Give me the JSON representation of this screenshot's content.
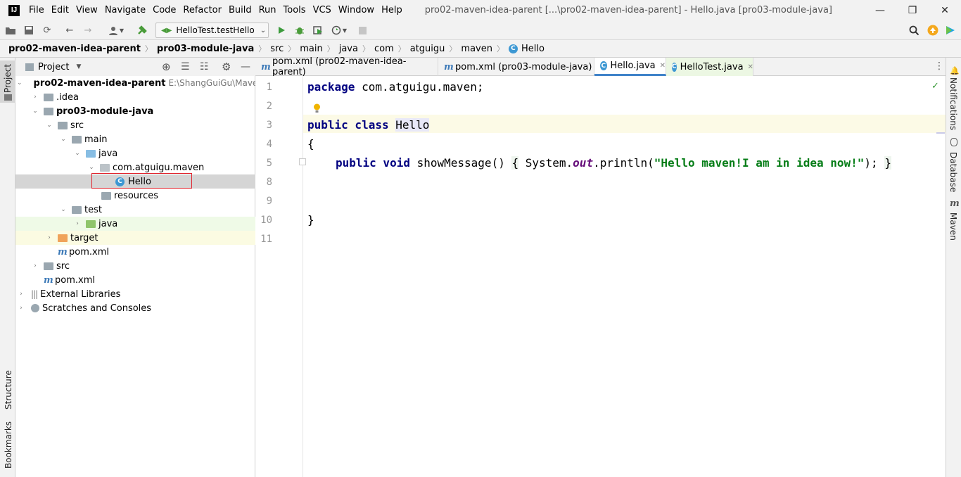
{
  "app": {
    "logo": "IJ",
    "title": "pro02-maven-idea-parent [...\\pro02-maven-idea-parent] - Hello.java [pro03-module-java]",
    "menus": [
      "File",
      "Edit",
      "View",
      "Navigate",
      "Code",
      "Refactor",
      "Build",
      "Run",
      "Tools",
      "VCS",
      "Window",
      "Help"
    ]
  },
  "toolbar": {
    "run_config": "HelloTest.testHello"
  },
  "breadcrumb": [
    "pro02-maven-idea-parent",
    "pro03-module-java",
    "src",
    "main",
    "java",
    "com",
    "atguigu",
    "maven",
    "Hello"
  ],
  "left_strip": [
    "Project",
    "Structure",
    "Bookmarks"
  ],
  "right_strip": [
    "Notifications",
    "Database",
    "Maven"
  ],
  "project_panel": {
    "title": "Project",
    "tree": [
      {
        "label": "pro02-maven-idea-parent",
        "path": "E:\\ShangGuiGu\\Maven\\i",
        "bold": true
      },
      {
        "label": ".idea"
      },
      {
        "label": "pro03-module-java",
        "bold": true
      },
      {
        "label": "src"
      },
      {
        "label": "main"
      },
      {
        "label": "java"
      },
      {
        "label": "com.atguigu.maven"
      },
      {
        "label": "Hello"
      },
      {
        "label": "resources"
      },
      {
        "label": "test"
      },
      {
        "label": "java"
      },
      {
        "label": "target"
      },
      {
        "label": "pom.xml"
      },
      {
        "label": "src"
      },
      {
        "label": "pom.xml"
      },
      {
        "label": "External Libraries"
      },
      {
        "label": "Scratches and Consoles"
      }
    ]
  },
  "tabs": [
    {
      "label": "pom.xml (pro02-maven-idea-parent)",
      "icon": "maven-icon"
    },
    {
      "label": "pom.xml (pro03-module-java)",
      "icon": "maven-icon"
    },
    {
      "label": "Hello.java",
      "icon": "class-icon",
      "active": true
    },
    {
      "label": "HelloTest.java",
      "icon": "class-icon"
    }
  ],
  "editor": {
    "line_numbers": [
      "1",
      "2",
      "3",
      "4",
      "5",
      "8",
      "9",
      "10",
      "11"
    ],
    "code": {
      "line1_kw": "package",
      "line1_rest": " com.atguigu.maven;",
      "line3_kw": "public class",
      "line3_name": "Hello",
      "line4": "{",
      "line5_kw": "public void",
      "line5_a": " showMessage() ",
      "line5_b": "{",
      "line5_c": " System.",
      "line5_out": "out",
      "line5_d": ".println(",
      "line5_str": "\"Hello maven!I am in idea now!\"",
      "line5_e": "); ",
      "line5_f": "}",
      "line10": "}"
    }
  }
}
